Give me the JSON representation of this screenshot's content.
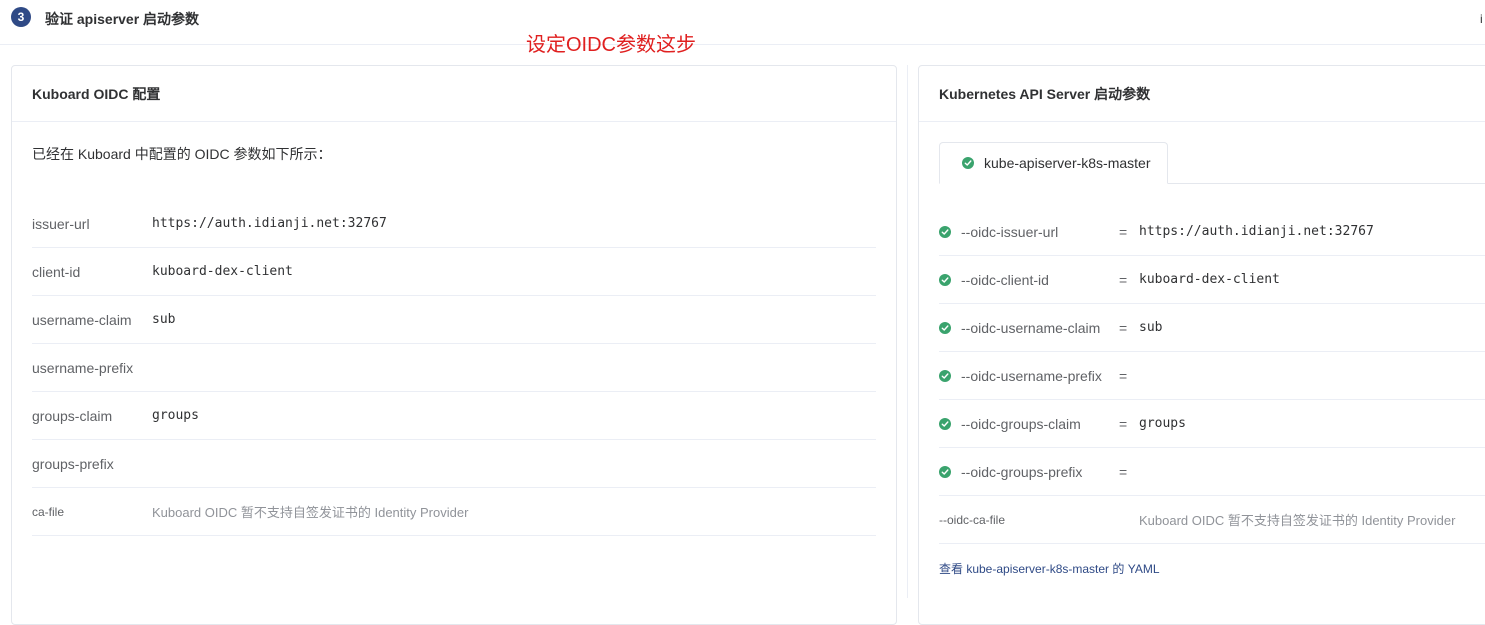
{
  "step": {
    "number": "3",
    "title": "验证 apiserver 启动参数",
    "edge_mark": "i"
  },
  "annotation": "设定OIDC参数这步",
  "left_card": {
    "title": "Kuboard OIDC 配置",
    "intro": "已经在 Kuboard 中配置的 OIDC 参数如下所示：",
    "rows": [
      {
        "key": "issuer-url",
        "value": "https://auth.idianji.net:32767"
      },
      {
        "key": "client-id",
        "value": "kuboard-dex-client"
      },
      {
        "key": "username-claim",
        "value": "sub"
      },
      {
        "key": "username-prefix",
        "value": ""
      },
      {
        "key": "groups-claim",
        "value": "groups"
      },
      {
        "key": "groups-prefix",
        "value": ""
      },
      {
        "key": "ca-file",
        "value": "Kuboard OIDC 暂不支持自签发证书的 Identity Provider"
      }
    ]
  },
  "right_card": {
    "title": "Kubernetes API Server 启动参数",
    "tab": "kube-apiserver-k8s-master",
    "eq": "=",
    "rows": [
      {
        "key": "--oidc-issuer-url",
        "value": "https://auth.idianji.net:32767"
      },
      {
        "key": "--oidc-client-id",
        "value": "kuboard-dex-client"
      },
      {
        "key": "--oidc-username-claim",
        "value": "sub"
      },
      {
        "key": "--oidc-username-prefix",
        "value": ""
      },
      {
        "key": "--oidc-groups-claim",
        "value": "groups"
      },
      {
        "key": "--oidc-groups-prefix",
        "value": ""
      },
      {
        "key": "--oidc-ca-file",
        "value": "Kuboard OIDC 暂不支持自签发证书的 Identity Provider"
      }
    ],
    "yaml_link": "查看 kube-apiserver-k8s-master 的 YAML"
  },
  "colors": {
    "accent": "#2f4a86",
    "success": "#3aa36d",
    "annotation": "#e02020"
  }
}
